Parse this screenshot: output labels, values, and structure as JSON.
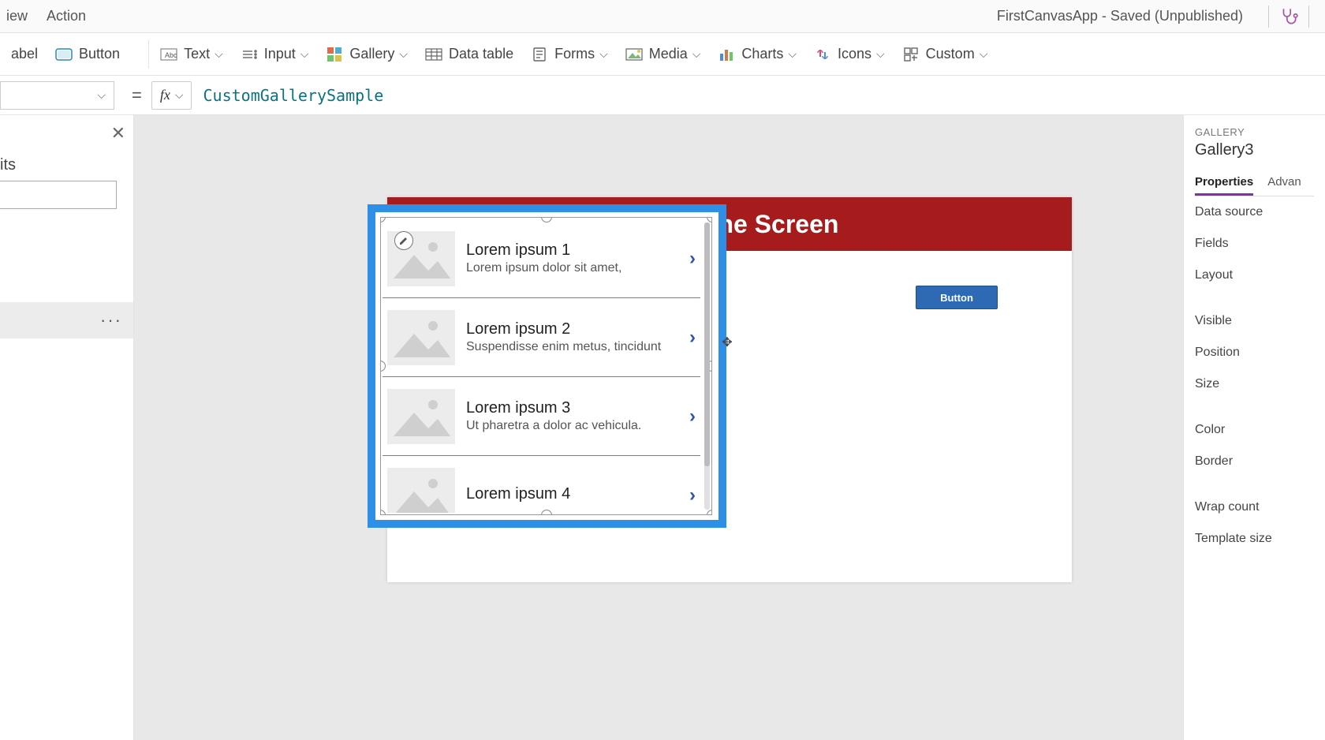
{
  "menu": {
    "view": "iew",
    "action": "Action",
    "app_title": "FirstCanvasApp - Saved (Unpublished)"
  },
  "ribbon": {
    "label": "abel",
    "button": "Button",
    "text": "Text",
    "input": "Input",
    "gallery": "Gallery",
    "data_table": "Data table",
    "forms": "Forms",
    "media": "Media",
    "charts": "Charts",
    "icons": "Icons",
    "custom": "Custom"
  },
  "formula": {
    "value": "CustomGallerySample",
    "fx": "fx"
  },
  "left": {
    "heading": "its",
    "ellipsis": "···"
  },
  "screen": {
    "title": "Title of the Screen",
    "button_label": "Button"
  },
  "gallery": {
    "items": [
      {
        "title": "Lorem ipsum 1",
        "sub": "Lorem ipsum dolor sit amet,"
      },
      {
        "title": "Lorem ipsum 2",
        "sub": "Suspendisse enim metus, tincidunt"
      },
      {
        "title": "Lorem ipsum 3",
        "sub": "Ut pharetra a dolor ac vehicula."
      },
      {
        "title": "Lorem ipsum 4",
        "sub": ""
      }
    ]
  },
  "props": {
    "category": "GALLERY",
    "name": "Gallery3",
    "tabs": {
      "properties": "Properties",
      "advanced": "Advan"
    },
    "rows": {
      "data_source": "Data source",
      "fields": "Fields",
      "layout": "Layout",
      "visible": "Visible",
      "position": "Position",
      "size": "Size",
      "color": "Color",
      "border": "Border",
      "wrap_count": "Wrap count",
      "template_size": "Template size"
    }
  }
}
